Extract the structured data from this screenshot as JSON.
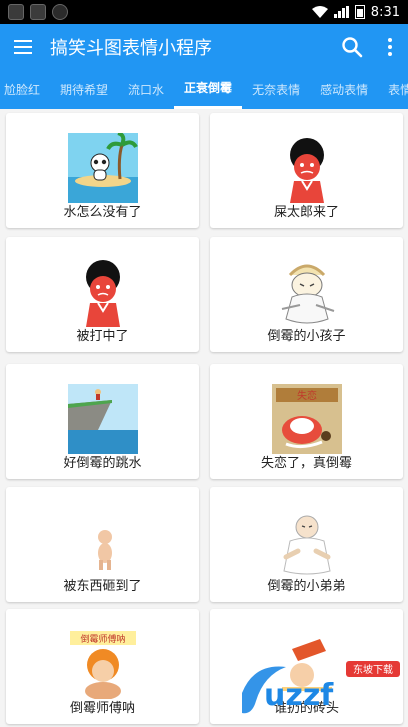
{
  "status_bar": {
    "time": "8:31"
  },
  "app_bar": {
    "title": "搞笑斗图表情小程序",
    "menu_icon": "hamburger-menu-icon",
    "search_icon": "search-icon",
    "more_icon": "more-vert-icon"
  },
  "tabs": [
    {
      "label": "尬脸红"
    },
    {
      "label": "期待希望"
    },
    {
      "label": "流口水"
    },
    {
      "label": "正衰倒霉",
      "active": true
    },
    {
      "label": "无奈表情"
    },
    {
      "label": "感动表情"
    },
    {
      "label": "表情"
    }
  ],
  "cards": [
    {
      "caption": "水怎么没有了",
      "icon": "beach-panda-image"
    },
    {
      "caption": "屎太郎来了",
      "icon": "afro-red-face-image"
    },
    {
      "caption": "被打中了",
      "icon": "afro-red-face-image"
    },
    {
      "caption": "倒霉的小孩子",
      "icon": "sketch-kid-image"
    },
    {
      "caption": "好倒霉的跳水",
      "icon": "diving-cliff-image"
    },
    {
      "caption": "失恋了，真倒霉",
      "icon": "crying-character-image"
    },
    {
      "caption": "被东西砸到了",
      "icon": "small-baby-image"
    },
    {
      "caption": "倒霉的小弟弟",
      "icon": "old-baby-image"
    },
    {
      "caption": "倒霉师傅呐",
      "icon": "baby-with-sign-image"
    },
    {
      "caption": "谁扔的砖头",
      "icon": "brick-hit-image"
    }
  ],
  "card_9_sign": "倒霉师傅呐",
  "watermark": {
    "brand": "uzzf",
    "tag": "东坡下载"
  }
}
